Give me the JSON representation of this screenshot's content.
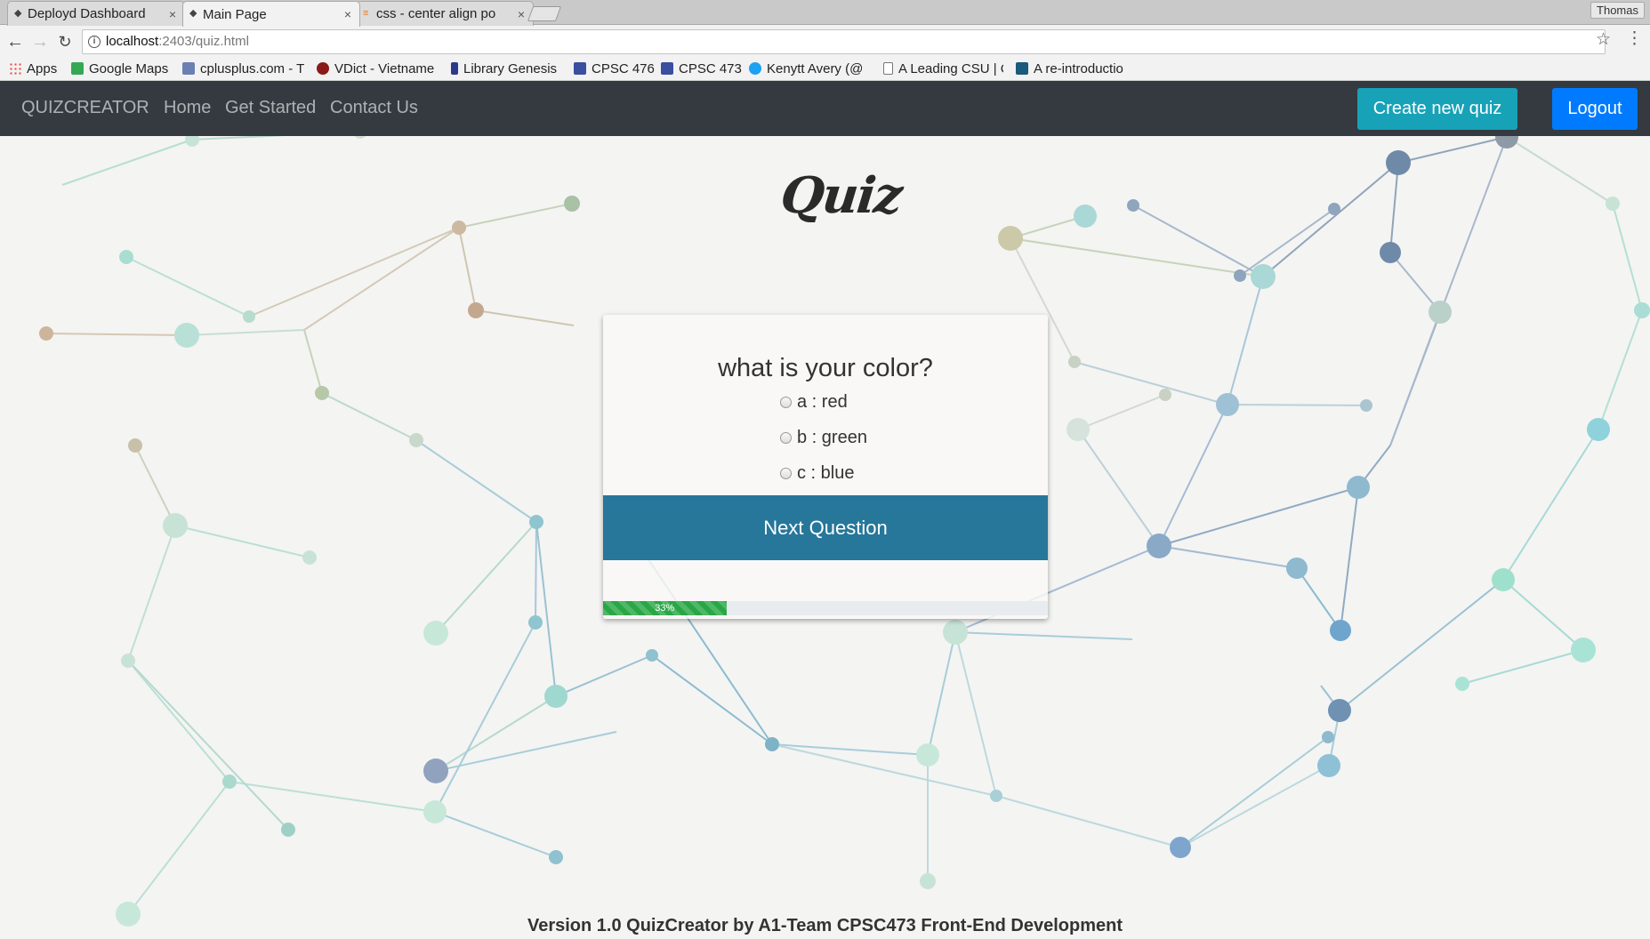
{
  "browser": {
    "tabs": [
      {
        "title": "Deployd Dashboard",
        "active": false
      },
      {
        "title": "Main Page",
        "active": true
      },
      {
        "title": "css - center align po",
        "active": false
      }
    ],
    "profile_name": "Thomas",
    "url_host": "localhost",
    "url_path": ":2403/quiz.html",
    "bookmarks": [
      {
        "label": "Apps",
        "icon": "apps-grid-icon",
        "color": "#e8453c"
      },
      {
        "label": "Google Maps",
        "icon": "maps-icon",
        "color": "#34a853"
      },
      {
        "label": "cplusplus.com - T",
        "icon": "cplusplus-icon",
        "color": "#6b7fb3"
      },
      {
        "label": "VDict - Vietname",
        "icon": "vdict-icon",
        "color": "#8b1a1a"
      },
      {
        "label": "Library Genesis",
        "icon": "libgen-icon",
        "color": "#2b3a8c"
      },
      {
        "label": "CPSC 476",
        "icon": "calendar-icon",
        "color": "#3a4fa0"
      },
      {
        "label": "CPSC 473",
        "icon": "calendar-icon",
        "color": "#3a4fa0"
      },
      {
        "label": "Kenytt Avery (@",
        "icon": "twitter-icon",
        "color": "#1da1f2"
      },
      {
        "label": "A Leading CSU | C",
        "icon": "page-icon",
        "color": "#777777"
      },
      {
        "label": "A re-introductio",
        "icon": "mdn-icon",
        "color": "#1a5a7a"
      }
    ]
  },
  "nav": {
    "brand": "QUIZCREATOR",
    "links": [
      "Home",
      "Get Started",
      "Contact Us"
    ],
    "create_label": "Create new quiz",
    "logout_label": "Logout"
  },
  "logo_text": "Quiz",
  "quiz": {
    "question": "what is your color?",
    "answers": [
      "a : red",
      "b : green",
      "c : blue"
    ],
    "next_label": "Next Question",
    "progress_percent": 33,
    "progress_label": "33%"
  },
  "footer": "Version 1.0 QuizCreator by A1-Team CPSC473 Front-End Development",
  "colors": {
    "navbar": "#343a40",
    "create_button": "#17a2b8",
    "logout_button": "#007bff",
    "next_button": "#26779a",
    "progress_bar": "#28a745"
  }
}
